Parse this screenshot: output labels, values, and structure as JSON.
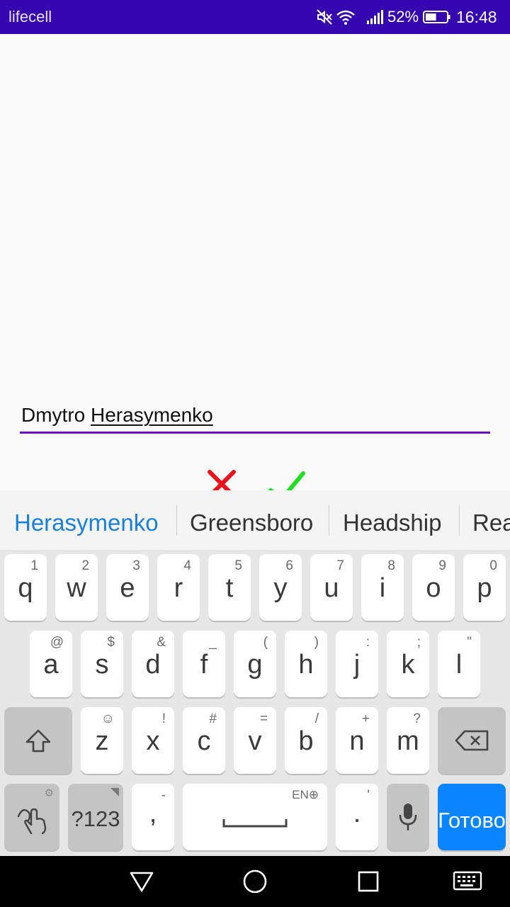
{
  "status_bar": {
    "carrier": "lifecell",
    "battery_percent": "52%",
    "time": "16:48",
    "icons": [
      "mute-icon",
      "wifi-icon",
      "signal-icon",
      "battery-icon"
    ],
    "battery_level": 0.52,
    "background_color": "#3505b0"
  },
  "editor": {
    "first_word": "Dmytro",
    "composing_word": "Herasymenko",
    "underline_color": "#6a0dc9",
    "cancel_icon": "close-icon",
    "confirm_icon": "check-icon",
    "cancel_color": "#e8141b",
    "confirm_color": "#22dd22"
  },
  "suggestions": {
    "items": [
      "Herasymenko",
      "Greensboro",
      "Headship",
      "Rea"
    ],
    "primary_color": "#1a7fd8"
  },
  "keyboard": {
    "row1": [
      {
        "label": "q",
        "hint": "1"
      },
      {
        "label": "w",
        "hint": "2"
      },
      {
        "label": "e",
        "hint": "3"
      },
      {
        "label": "r",
        "hint": "4"
      },
      {
        "label": "t",
        "hint": "5"
      },
      {
        "label": "y",
        "hint": "6"
      },
      {
        "label": "u",
        "hint": "7"
      },
      {
        "label": "i",
        "hint": "8"
      },
      {
        "label": "o",
        "hint": "9"
      },
      {
        "label": "p",
        "hint": "0"
      }
    ],
    "row2": [
      {
        "label": "a",
        "hint": "@"
      },
      {
        "label": "s",
        "hint": "$"
      },
      {
        "label": "d",
        "hint": "&"
      },
      {
        "label": "f",
        "hint": "_"
      },
      {
        "label": "g",
        "hint": "("
      },
      {
        "label": "h",
        "hint": ")"
      },
      {
        "label": "j",
        "hint": ":"
      },
      {
        "label": "k",
        "hint": ";"
      },
      {
        "label": "l",
        "hint": "\""
      }
    ],
    "row3": [
      {
        "label": "z",
        "hint": "☺"
      },
      {
        "label": "x",
        "hint": "!"
      },
      {
        "label": "c",
        "hint": "#"
      },
      {
        "label": "v",
        "hint": "="
      },
      {
        "label": "b",
        "hint": "/"
      },
      {
        "label": "n",
        "hint": "+"
      },
      {
        "label": "m",
        "hint": "?"
      }
    ],
    "shift_icon": "shift-icon",
    "backspace_icon": "backspace-icon",
    "gesture_icon": "gesture-icon",
    "symbols_label": "?123",
    "comma_label": ",",
    "comma_hint": "-",
    "space_hint": "EN⊕",
    "period_label": ".",
    "period_hint": "'",
    "mic_icon": "microphone-icon",
    "action_label": "Готово",
    "action_color": "#0a84ff"
  },
  "nav_bar": {
    "buttons": [
      "back-icon",
      "home-icon",
      "recents-icon",
      "keyboard-switch-icon"
    ]
  }
}
